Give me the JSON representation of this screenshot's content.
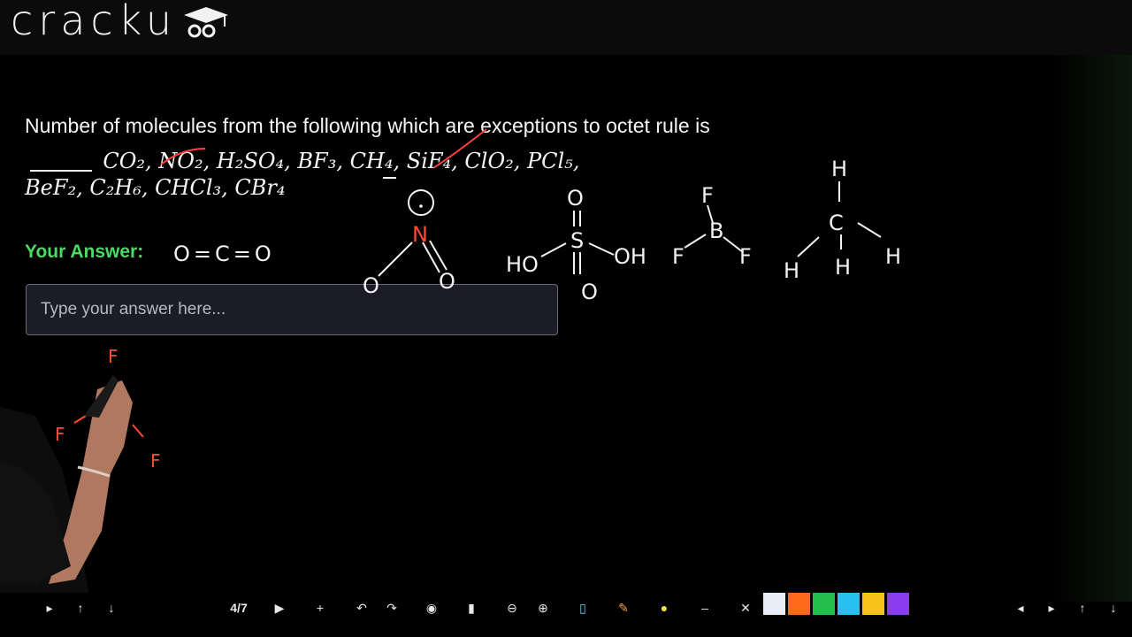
{
  "app": {
    "logo_text": "crack",
    "logo_suffix": "u"
  },
  "question": {
    "text_prefix": "Number of molecules from the following which are exceptions to octet rule is",
    "line1_formulas": "CO₂, NO₂, H₂SO₄, BF₃, CH₄, SiF₄, ClO₂, PCl₅,",
    "line2_formulas": "BeF₂, C₂H₆, CHCl₃, CBr₄"
  },
  "answer": {
    "label": "Your Answer:",
    "placeholder": "Type your answer here..."
  },
  "board": {
    "co2_structure": "O=C=O",
    "no2": {
      "n": "N",
      "o1": "O",
      "o2": "O"
    },
    "h2so4": {
      "s": "S",
      "ho": "HO",
      "oh": "OH",
      "o_top": "O",
      "o_bottom": "O"
    },
    "bf3": {
      "b": "B",
      "f_top": "F",
      "f_left": "F",
      "f_right": "F"
    },
    "ch4": {
      "c": "C",
      "h_top": "H",
      "h_left": "H",
      "h_bottom": "H",
      "h_right": "H"
    },
    "bf3_lower": {
      "f_top": "F",
      "f_left": "F",
      "f_right": "F"
    }
  },
  "toolbar": {
    "page_indicator": "4/7",
    "swatches": [
      "#e8eef8",
      "#ff6a1a",
      "#22c04a",
      "#28c0f0",
      "#f7c21c",
      "#8a3cf0"
    ],
    "icons": [
      "play-icon",
      "up-icon",
      "down-icon",
      "next-icon",
      "plus-icon",
      "undo-icon",
      "redo-icon",
      "eye-icon",
      "page-icon",
      "zoom-out-icon",
      "zoom-in-icon",
      "trash-icon",
      "pen-icon",
      "highlighter-icon",
      "minus-icon",
      "close-icon",
      "prev-nav-icon",
      "next-nav-icon",
      "arrow-up-icon",
      "arrow-down-icon"
    ]
  }
}
